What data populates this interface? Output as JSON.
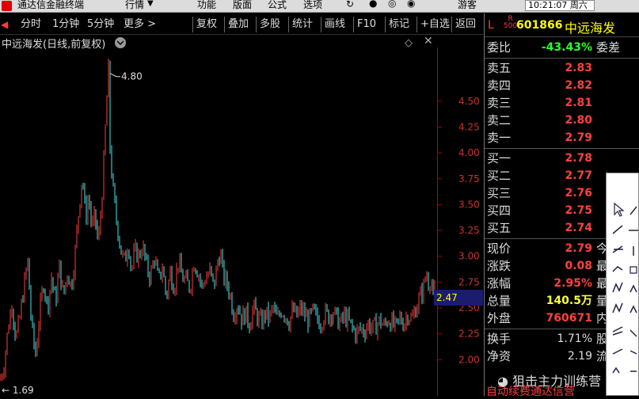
{
  "menubar": {
    "app_title": "通达信金融终端",
    "items": [
      "行情",
      "功能",
      "版面",
      "公式",
      "选项"
    ],
    "broker": "游客",
    "time": "10:21:07 周六"
  },
  "toolbar": {
    "left": [
      "分时",
      "1分钟",
      "5分钟",
      "更多 >"
    ],
    "right": [
      "复权",
      "叠加",
      "多股",
      "统计",
      "画线",
      "F10",
      "标记",
      "+自选",
      "返回"
    ]
  },
  "chart_header": {
    "title": "中远海发(日线,前复权)",
    "peak_label": "4.80",
    "low_label": "1.69",
    "current_price_marker": "2.47"
  },
  "chart_data": {
    "type": "candlestick",
    "series": [
      {
        "name": "中远海发",
        "points": [
          [
            0,
            1.8
          ],
          [
            5,
            1.95
          ],
          [
            10,
            2.3
          ],
          [
            15,
            2.55
          ],
          [
            20,
            2.2
          ],
          [
            25,
            2.4
          ],
          [
            30,
            2.7
          ],
          [
            35,
            2.95
          ],
          [
            40,
            2.3
          ],
          [
            45,
            2.05
          ],
          [
            50,
            2.45
          ],
          [
            55,
            2.75
          ],
          [
            60,
            2.5
          ],
          [
            65,
            2.8
          ],
          [
            70,
            2.55
          ],
          [
            75,
            2.9
          ],
          [
            80,
            2.6
          ],
          [
            85,
            2.85
          ],
          [
            90,
            2.7
          ],
          [
            95,
            3.05
          ],
          [
            100,
            3.5
          ],
          [
            104,
            3.8
          ],
          [
            108,
            3.35
          ],
          [
            112,
            3.6
          ],
          [
            116,
            3.25
          ],
          [
            120,
            3.4
          ],
          [
            124,
            3.1
          ],
          [
            128,
            3.5
          ],
          [
            131,
            3.9
          ],
          [
            134,
            4.4
          ],
          [
            137,
            4.8
          ],
          [
            139,
            4.05
          ],
          [
            142,
            3.7
          ],
          [
            146,
            3.4
          ],
          [
            150,
            3.2
          ],
          [
            154,
            3.0
          ],
          [
            158,
            2.95
          ],
          [
            162,
            3.15
          ],
          [
            166,
            2.85
          ],
          [
            170,
            3.05
          ],
          [
            175,
            3.0
          ],
          [
            180,
            3.1
          ],
          [
            185,
            2.9
          ],
          [
            190,
            2.8
          ],
          [
            195,
            3.0
          ],
          [
            200,
            2.75
          ],
          [
            205,
            2.9
          ],
          [
            210,
            2.6
          ],
          [
            215,
            2.85
          ],
          [
            220,
            2.7
          ],
          [
            225,
            2.95
          ],
          [
            230,
            2.8
          ],
          [
            235,
            2.75
          ],
          [
            240,
            2.7
          ],
          [
            245,
            2.95
          ],
          [
            250,
            2.85
          ],
          [
            255,
            2.7
          ],
          [
            260,
            2.8
          ],
          [
            265,
            2.85
          ],
          [
            270,
            2.7
          ],
          [
            275,
            2.95
          ],
          [
            278,
            3.05
          ],
          [
            282,
            2.8
          ],
          [
            286,
            2.75
          ],
          [
            290,
            2.65
          ],
          [
            295,
            2.45
          ],
          [
            300,
            2.55
          ],
          [
            305,
            2.4
          ],
          [
            310,
            2.45
          ],
          [
            315,
            2.35
          ],
          [
            320,
            2.5
          ],
          [
            325,
            2.42
          ],
          [
            330,
            2.35
          ],
          [
            335,
            2.45
          ],
          [
            340,
            2.4
          ],
          [
            345,
            2.5
          ],
          [
            350,
            2.38
          ],
          [
            355,
            2.48
          ],
          [
            360,
            2.44
          ],
          [
            365,
            2.37
          ],
          [
            370,
            2.48
          ],
          [
            375,
            2.42
          ],
          [
            380,
            2.5
          ],
          [
            385,
            2.43
          ],
          [
            390,
            2.38
          ],
          [
            395,
            2.46
          ],
          [
            400,
            2.4
          ],
          [
            405,
            2.36
          ],
          [
            410,
            2.45
          ],
          [
            415,
            2.42
          ],
          [
            420,
            2.48
          ],
          [
            425,
            2.4
          ],
          [
            430,
            2.35
          ],
          [
            435,
            2.42
          ],
          [
            440,
            2.37
          ],
          [
            445,
            2.3
          ],
          [
            450,
            2.25
          ],
          [
            455,
            2.3
          ],
          [
            460,
            2.28
          ],
          [
            465,
            2.35
          ],
          [
            470,
            2.3
          ],
          [
            475,
            2.33
          ],
          [
            480,
            2.38
          ],
          [
            485,
            2.32
          ],
          [
            490,
            2.4
          ],
          [
            495,
            2.35
          ],
          [
            500,
            2.3
          ],
          [
            505,
            2.4
          ],
          [
            510,
            2.35
          ],
          [
            515,
            2.45
          ],
          [
            520,
            2.38
          ],
          [
            525,
            2.5
          ],
          [
            530,
            2.6
          ],
          [
            535,
            2.7
          ],
          [
            538,
            2.85
          ],
          [
            541,
            2.75
          ],
          [
            544,
            2.8
          ],
          [
            547,
            2.6
          ],
          [
            550,
            2.7
          ]
        ]
      }
    ],
    "ylim": [
      1.65,
      5.02
    ],
    "yticks": [
      2.0,
      2.25,
      2.5,
      2.75,
      3.0,
      3.25,
      3.5,
      3.75,
      4.0,
      4.25,
      4.5
    ],
    "ytick_labels": [
      "2.00",
      "2.25",
      "2.50",
      "2.75",
      "3.00",
      "3.25",
      "3.50",
      "3.75",
      "4.00",
      "4.25",
      "4.50"
    ]
  },
  "panel": {
    "header": {
      "market": "L",
      "flag": "R",
      "flag_sub": "500",
      "code": "601866",
      "name": "中远海发"
    },
    "weibi": {
      "label": "委比",
      "value": "-43.43%",
      "label2": "委差"
    },
    "asks": [
      {
        "label": "卖五",
        "price": "2.83"
      },
      {
        "label": "卖四",
        "price": "2.82"
      },
      {
        "label": "卖三",
        "price": "2.81"
      },
      {
        "label": "卖二",
        "price": "2.80"
      },
      {
        "label": "卖一",
        "price": "2.79"
      }
    ],
    "bids": [
      {
        "label": "买一",
        "price": "2.78"
      },
      {
        "label": "买二",
        "price": "2.77"
      },
      {
        "label": "买三",
        "price": "2.76"
      },
      {
        "label": "买四",
        "price": "2.75"
      },
      {
        "label": "买五",
        "price": "2.74"
      }
    ],
    "stats": [
      {
        "label": "现价",
        "value": "2.79",
        "label2": "今",
        "color": "red"
      },
      {
        "label": "涨跌",
        "value": "0.08",
        "label2": "最",
        "color": "red"
      },
      {
        "label": "涨幅",
        "value": "2.95%",
        "label2": "最",
        "color": "red"
      },
      {
        "label": "总量",
        "value": "140.5万",
        "label2": "量",
        "color": "yellow"
      },
      {
        "label": "外盘",
        "value": "760671",
        "label2": "内",
        "color": "red"
      }
    ],
    "stats2": [
      {
        "label": "换手",
        "value": "1.71%",
        "label2": "股"
      },
      {
        "label": "净资",
        "value": "2.19",
        "label2": "流"
      }
    ],
    "footer": "自动续费通达信营"
  },
  "watermark": "狙击主力训练营",
  "colors": {
    "up": "#ff3b3b",
    "down": "#43e8e8",
    "grid": "#b00000",
    "axis_text": "#c83232"
  }
}
